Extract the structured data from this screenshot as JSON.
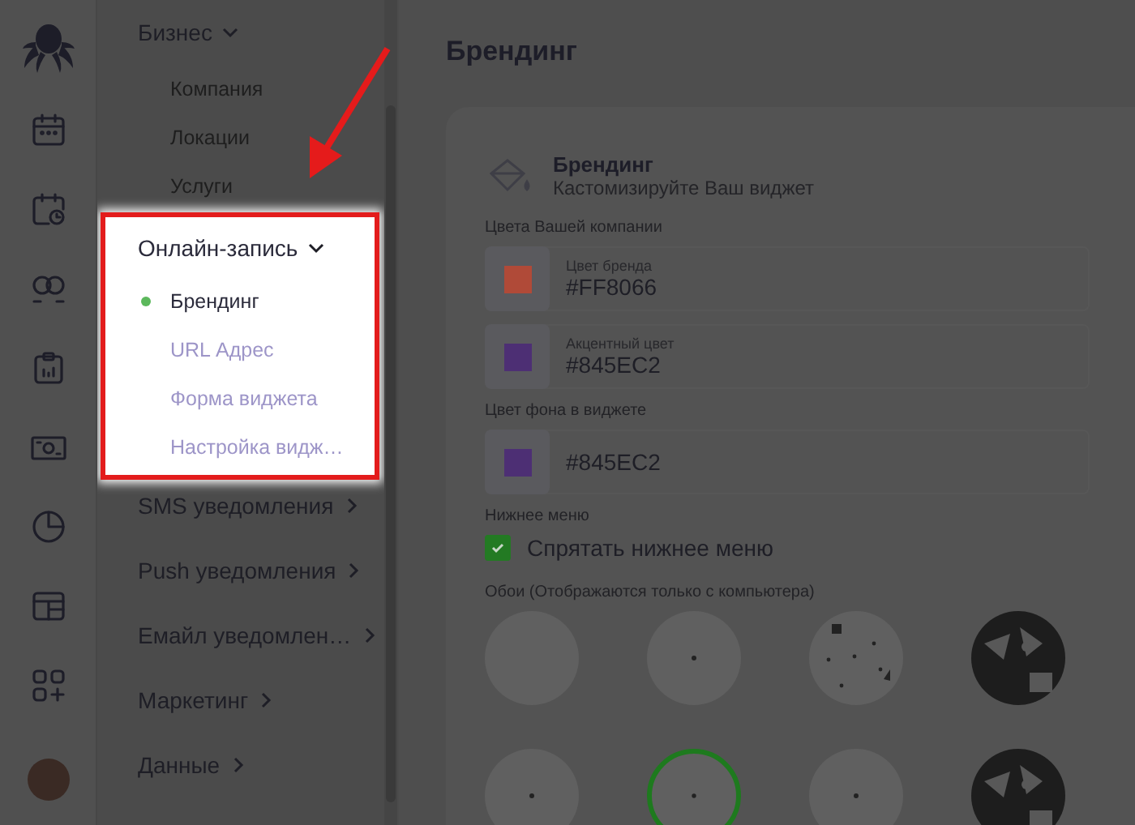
{
  "rail": {
    "items": [
      {
        "kind": "calendar"
      },
      {
        "kind": "calendar-clock"
      },
      {
        "kind": "people"
      },
      {
        "kind": "clipboard"
      },
      {
        "kind": "money"
      },
      {
        "kind": "pie"
      },
      {
        "kind": "layout"
      },
      {
        "kind": "grid-plus"
      }
    ]
  },
  "submenu": {
    "sections": [
      {
        "label": "Бизнес",
        "expanded": true,
        "highlighted": false,
        "children": [
          {
            "label": "Компания",
            "selected": false
          },
          {
            "label": "Локации",
            "selected": false
          },
          {
            "label": "Услуги",
            "selected": false
          }
        ]
      },
      {
        "label": "Онлайн-запись",
        "expanded": true,
        "highlighted": true,
        "children": [
          {
            "label": "Брендинг",
            "selected": true
          },
          {
            "label": "URL Адрес",
            "selected": false
          },
          {
            "label": "Форма виджета",
            "selected": false
          },
          {
            "label": "Настройка видж…",
            "selected": false
          }
        ]
      },
      {
        "label": "SMS уведомления",
        "expanded": false,
        "highlighted": false
      },
      {
        "label": "Push уведомления",
        "expanded": false,
        "highlighted": false
      },
      {
        "label": "Емайл уведомлен…",
        "expanded": false,
        "highlighted": false
      },
      {
        "label": "Маркетинг",
        "expanded": false,
        "highlighted": false
      },
      {
        "label": "Данные",
        "expanded": false,
        "highlighted": false
      }
    ]
  },
  "main": {
    "title": "Брендинг",
    "card": {
      "title": "Брендинг",
      "subtitle": "Кастомизируйте Ваш виджет",
      "groups": [
        {
          "label": "Цвета Вашей компании",
          "kind": "colors",
          "fields": [
            {
              "label": "Цвет бренда",
              "value": "#FF8066",
              "color": "#b04a38"
            },
            {
              "label": "Акцентный цвет",
              "value": "#845EC2",
              "color": "#4d2f74"
            }
          ]
        },
        {
          "label": "Цвет фона в виджете",
          "kind": "colors",
          "fields": [
            {
              "value": "#845EC2",
              "color": "#4d2f74"
            }
          ]
        },
        {
          "label": "Нижнее меню",
          "kind": "checkbox",
          "checkbox": {
            "label": "Спрятать нижнее меню",
            "checked": true
          }
        },
        {
          "label": "Обои (Отображаются только с компьютера)",
          "kind": "wallpapers",
          "wallpapers": [
            {
              "kind": "plain",
              "selected": false
            },
            {
              "kind": "dot",
              "selected": false
            },
            {
              "kind": "speckles",
              "selected": false
            },
            {
              "kind": "shapes",
              "selected": false
            },
            {
              "kind": "dot",
              "selected": false
            },
            {
              "kind": "dot",
              "selected": true
            },
            {
              "kind": "dot",
              "selected": false
            },
            {
              "kind": "shapes",
              "selected": false
            }
          ]
        }
      ]
    }
  }
}
